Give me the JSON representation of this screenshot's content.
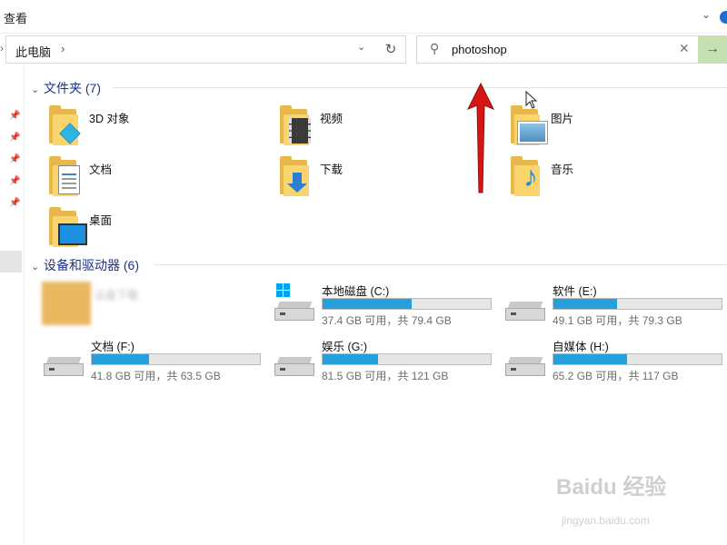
{
  "ribbon": {
    "tab_view": "查看"
  },
  "address": {
    "location": "此电脑",
    "separator": "›"
  },
  "search": {
    "value": "photoshop",
    "placeholder": ""
  },
  "folders": {
    "title": "文件夹 (7)",
    "items": [
      {
        "label": "3D 对象",
        "icon": "3d-objects-icon"
      },
      {
        "label": "视频",
        "icon": "video-icon"
      },
      {
        "label": "图片",
        "icon": "pictures-icon"
      },
      {
        "label": "文档",
        "icon": "documents-icon"
      },
      {
        "label": "下载",
        "icon": "download-icon"
      },
      {
        "label": "音乐",
        "icon": "music-icon"
      },
      {
        "label": "桌面",
        "icon": "desktop-icon"
      }
    ]
  },
  "devices": {
    "title": "设备和驱动器 (6)",
    "blurred_item": "云盘下载",
    "drives": [
      {
        "name": "本地磁盘 (C:)",
        "free": "37.4 GB 可用，共 79.4 GB",
        "used_fraction": 0.53
      },
      {
        "name": "软件 (E:)",
        "free": "49.1 GB 可用，共 79.3 GB",
        "used_fraction": 0.38
      },
      {
        "name": "文档 (F:)",
        "free": "41.8 GB 可用，共 63.5 GB",
        "used_fraction": 0.34
      },
      {
        "name": "娱乐 (G:)",
        "free": "81.5 GB 可用，共 121 GB",
        "used_fraction": 0.33
      },
      {
        "name": "自媒体 (H:)",
        "free": "65.2 GB 可用，共 117 GB",
        "used_fraction": 0.44
      }
    ]
  },
  "watermark": {
    "brand": "Baidu 经验",
    "url": "jingyan.baidu.com"
  },
  "colors": {
    "accent": "#26a0da",
    "section_title": "#1e3287",
    "go_button": "#c6e0b3",
    "annotation_arrow": "#d61515"
  }
}
